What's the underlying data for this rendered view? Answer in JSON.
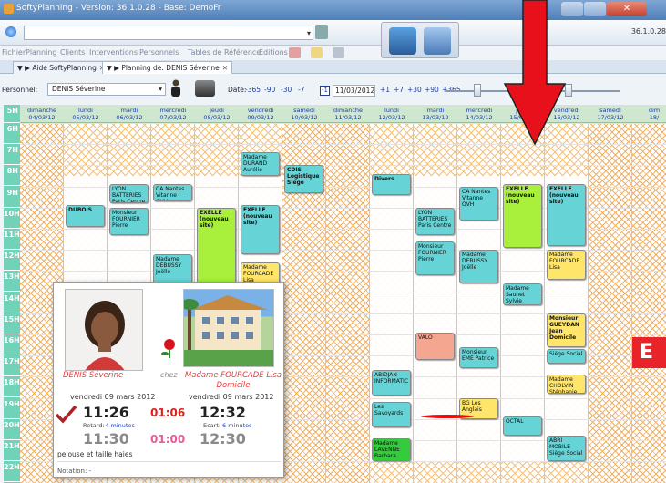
{
  "window": {
    "title": "SoftyPlanning - Version: 36.1.0.28 - Base: DemoFr",
    "version_right": "36.1.0.28"
  },
  "menu": [
    "Fichier",
    "Planning",
    "Clients",
    "Interventions",
    "Personnels",
    "Tables de Référence",
    "Editions"
  ],
  "tabs": [
    {
      "label": "Aide SoftyPlanning"
    },
    {
      "label": "Planning de: DENIS Séverine"
    }
  ],
  "controls": {
    "personnel_label": "Personnel:",
    "personnel_value": "DENIS Séverine",
    "date_label": "Date:",
    "back_steps": [
      "-365",
      "-90",
      "-30",
      "-7"
    ],
    "today_btn": "-1",
    "date_value": "11/03/2012",
    "forward_steps": [
      "+1",
      "+7",
      "+30",
      "+90",
      "+365"
    ]
  },
  "calendar": {
    "days": [
      {
        "name": "dimanche",
        "date": "04/03/12",
        "kind": "weekend"
      },
      {
        "name": "lundi",
        "date": "05/03/12",
        "kind": "week"
      },
      {
        "name": "mardi",
        "date": "06/03/12",
        "kind": "week"
      },
      {
        "name": "mercredi",
        "date": "07/03/12",
        "kind": "week"
      },
      {
        "name": "jeudi",
        "date": "08/03/12",
        "kind": "week"
      },
      {
        "name": "vendredi",
        "date": "09/03/12",
        "kind": "week"
      },
      {
        "name": "samedi",
        "date": "10/03/12",
        "kind": "weekend"
      },
      {
        "name": "dimanche",
        "date": "11/03/12",
        "kind": "weekend"
      },
      {
        "name": "lundi",
        "date": "12/03/12",
        "kind": "week"
      },
      {
        "name": "mardi",
        "date": "13/03/12",
        "kind": "week"
      },
      {
        "name": "mercredi",
        "date": "14/03/12",
        "kind": "week"
      },
      {
        "name": "jeudi",
        "date": "15/03/12",
        "kind": "week"
      },
      {
        "name": "vendredi",
        "date": "16/03/12",
        "kind": "week"
      },
      {
        "name": "samedi",
        "date": "17/03/12",
        "kind": "weekend"
      },
      {
        "name": "dim",
        "date": "18/",
        "kind": "weekend"
      }
    ],
    "hours": [
      "5H",
      "6H",
      "7H",
      "8H",
      "9H",
      "10H",
      "11H",
      "12H",
      "13H",
      "14H",
      "15H",
      "16H",
      "17H",
      "18H",
      "19H",
      "20H",
      "21H",
      "22H"
    ],
    "appointments": [
      {
        "day": 5,
        "start": 6.4,
        "end": 7.5,
        "color": "cyan",
        "lines": [
          "Madame",
          "DURAND",
          "Aurélie"
        ]
      },
      {
        "day": 6,
        "start": 7.0,
        "end": 8.3,
        "color": "cyan",
        "lines": [
          "CDIS",
          "Logistique",
          "Siège"
        ],
        "bold": true
      },
      {
        "day": 1,
        "start": 8.9,
        "end": 9.9,
        "color": "cyan",
        "lines": [
          "DUBOIS"
        ],
        "bold": true
      },
      {
        "day": 2,
        "start": 7.9,
        "end": 8.8,
        "color": "cyan",
        "lines": [
          "LYON",
          "BATTERIES",
          "Paris Centre"
        ]
      },
      {
        "day": 3,
        "start": 7.9,
        "end": 8.7,
        "color": "cyan",
        "lines": [
          "CA Nantes",
          "Vitanne OVH"
        ]
      },
      {
        "day": 2,
        "start": 9.0,
        "end": 10.3,
        "color": "cyan",
        "lines": [
          "Monsieur",
          "FOURNIER",
          "Pierre"
        ]
      },
      {
        "day": 4,
        "start": 9.0,
        "end": 12.6,
        "color": "lime",
        "lines": [
          "EXELLE",
          "(nouveau",
          "site)"
        ],
        "bold": true
      },
      {
        "day": 5,
        "start": 8.9,
        "end": 11.2,
        "color": "cyan",
        "lines": [
          "EXELLE",
          "(nouveau",
          "site)"
        ],
        "bold": true
      },
      {
        "day": 3,
        "start": 11.2,
        "end": 13.0,
        "color": "cyan",
        "lines": [
          "Madame",
          "DEBUSSY",
          "Joëlle"
        ]
      },
      {
        "day": 5,
        "start": 11.6,
        "end": 12.9,
        "color": "yellow",
        "lines": [
          "Madame",
          "FOURCADE",
          "Lisa"
        ]
      },
      {
        "day": 4,
        "start": 12.8,
        "end": 13.6,
        "color": "cyan",
        "lines": [
          "Madame",
          "Saunet Sylvie"
        ]
      },
      {
        "day": 1,
        "start": 12.8,
        "end": 13.6,
        "color": "cyan",
        "lines": [
          "Monsieur",
          "LAVENNE"
        ],
        "bold": true
      },
      {
        "day": 8,
        "start": 7.4,
        "end": 8.4,
        "color": "cyan",
        "lines": [
          "Divers"
        ],
        "bold": true
      },
      {
        "day": 9,
        "start": 9.0,
        "end": 10.3,
        "color": "cyan",
        "lines": [
          "LYON",
          "BATTERIES",
          "Paris Centre"
        ]
      },
      {
        "day": 9,
        "start": 10.6,
        "end": 12.2,
        "color": "cyan",
        "lines": [
          "Monsieur",
          "FOURNIER",
          "Pierre"
        ]
      },
      {
        "day": 10,
        "start": 8.0,
        "end": 9.6,
        "color": "cyan",
        "lines": [
          "CA Nantes",
          "Vitanne OVH"
        ]
      },
      {
        "day": 10,
        "start": 11.0,
        "end": 12.6,
        "color": "cyan",
        "lines": [
          "Madame",
          "DEBUSSY",
          "Joëlle"
        ]
      },
      {
        "day": 11,
        "start": 7.9,
        "end": 10.9,
        "color": "lime",
        "lines": [
          "EXELLE",
          "(nouveau",
          "site)"
        ],
        "bold": true
      },
      {
        "day": 12,
        "start": 7.9,
        "end": 10.8,
        "color": "cyan",
        "lines": [
          "EXELLE",
          "(nouveau",
          "site)"
        ],
        "bold": true
      },
      {
        "day": 11,
        "start": 12.6,
        "end": 13.6,
        "color": "cyan",
        "lines": [
          "Madame",
          "Saunet Sylvie",
          "Domicile"
        ]
      },
      {
        "day": 12,
        "start": 11.0,
        "end": 12.4,
        "color": "yellow",
        "lines": [
          "Madame",
          "FOURCADE",
          "Lisa"
        ]
      },
      {
        "day": 12,
        "start": 14.0,
        "end": 15.6,
        "color": "yellow",
        "lines": [
          "Monsieur",
          "GUEYDAN",
          "Jean",
          "Domicile"
        ],
        "bold": true
      },
      {
        "day": 12,
        "start": 15.7,
        "end": 16.4,
        "color": "cyan",
        "lines": [
          "Siège Social"
        ]
      },
      {
        "day": 12,
        "start": 16.9,
        "end": 17.8,
        "color": "yellow",
        "lines": [
          "Madame",
          "CHOLVIN",
          "Stéphanie"
        ]
      },
      {
        "day": 9,
        "start": 14.9,
        "end": 16.2,
        "color": "salmon",
        "lines": [
          "VALO"
        ]
      },
      {
        "day": 10,
        "start": 15.6,
        "end": 16.6,
        "color": "cyan",
        "lines": [
          "Monsieur",
          "EME Patrice"
        ]
      },
      {
        "day": 8,
        "start": 16.7,
        "end": 17.9,
        "color": "cyan",
        "lines": [
          "ABIDJAN",
          "INFORMATIC"
        ]
      },
      {
        "day": 8,
        "start": 18.2,
        "end": 19.4,
        "color": "cyan",
        "lines": [
          "Les",
          "Savoyards"
        ]
      },
      {
        "day": 10,
        "start": 18.0,
        "end": 19.0,
        "color": "yellow",
        "lines": [
          "BG Les",
          "Anglais"
        ]
      },
      {
        "day": 11,
        "start": 18.9,
        "end": 19.8,
        "color": "cyan",
        "lines": [
          "OCTAL"
        ]
      },
      {
        "day": 8,
        "start": 19.9,
        "end": 21.0,
        "color": "green",
        "lines": [
          "Madame",
          "LAVENNE",
          "Barbara"
        ]
      },
      {
        "day": 12,
        "start": 19.8,
        "end": 21.0,
        "color": "cyan",
        "lines": [
          "ABRI",
          "MOBILE",
          "Siège Social"
        ]
      },
      {
        "day": 5,
        "start": 14.0,
        "end": 15.0,
        "color": "yellow",
        "lines": [
          ""
        ]
      },
      {
        "day": 5,
        "start": 16.8,
        "end": 17.6,
        "color": "yellow",
        "lines": [
          ""
        ]
      },
      {
        "day": 5,
        "start": 19.8,
        "end": 20.6,
        "color": "lime",
        "lines": [
          ""
        ]
      }
    ]
  },
  "annotation_letter": "E",
  "popup": {
    "employee": "DENIS Séverine",
    "chez": "chez",
    "client": "Madame FOURCADE Lisa Domicile",
    "date_left": "vendredi 09 mars 2012",
    "date_right": "vendredi 09 mars 2012",
    "actual_start": "11:26",
    "duration_actual": "01:06",
    "actual_end": "12:32",
    "retard_label": "Retard:",
    "retard_value": "-4 minutes",
    "ecart_label": "Ecart:",
    "ecart_value": "6 minutes",
    "planned_start": "11:30",
    "duration_planned": "01:00",
    "planned_end": "12:30",
    "task": "pelouse et taille haies",
    "notation": "Notation: -"
  },
  "colors": {
    "accent_red": "#e53d3d",
    "hour_column": "#6fd2b9",
    "duration_actual": "#e0201c",
    "duration_planned": "#e85a9c",
    "retard": "#2040c0"
  }
}
